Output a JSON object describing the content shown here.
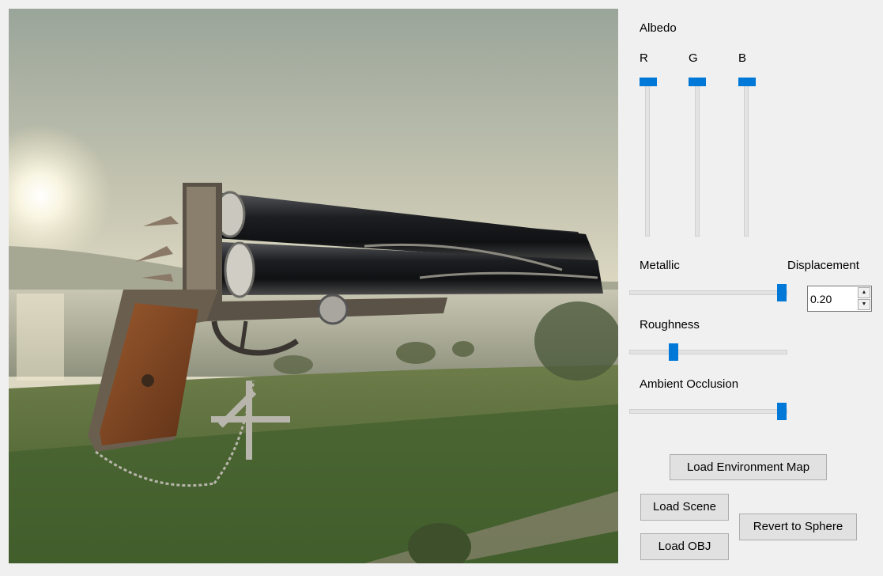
{
  "albedo": {
    "title": "Albedo",
    "channels": [
      {
        "label": "R",
        "value": 1.0
      },
      {
        "label": "G",
        "value": 1.0
      },
      {
        "label": "B",
        "value": 1.0
      }
    ]
  },
  "metallic": {
    "label": "Metallic",
    "value": 0.98
  },
  "roughness": {
    "label": "Roughness",
    "value": 0.28
  },
  "ambient_occlusion": {
    "label": "Ambient Occlusion",
    "value": 0.98
  },
  "displacement": {
    "label": "Displacement",
    "value": "0.20",
    "up_icon": "arrow-up-icon",
    "down_icon": "arrow-down-icon"
  },
  "buttons": {
    "load_environment_map": "Load Environment Map",
    "load_scene": "Load Scene",
    "load_obj": "Load OBJ",
    "revert_to_sphere": "Revert to Sphere"
  },
  "colors": {
    "accent": "#0078d7",
    "panel": "#f0f0f0"
  }
}
